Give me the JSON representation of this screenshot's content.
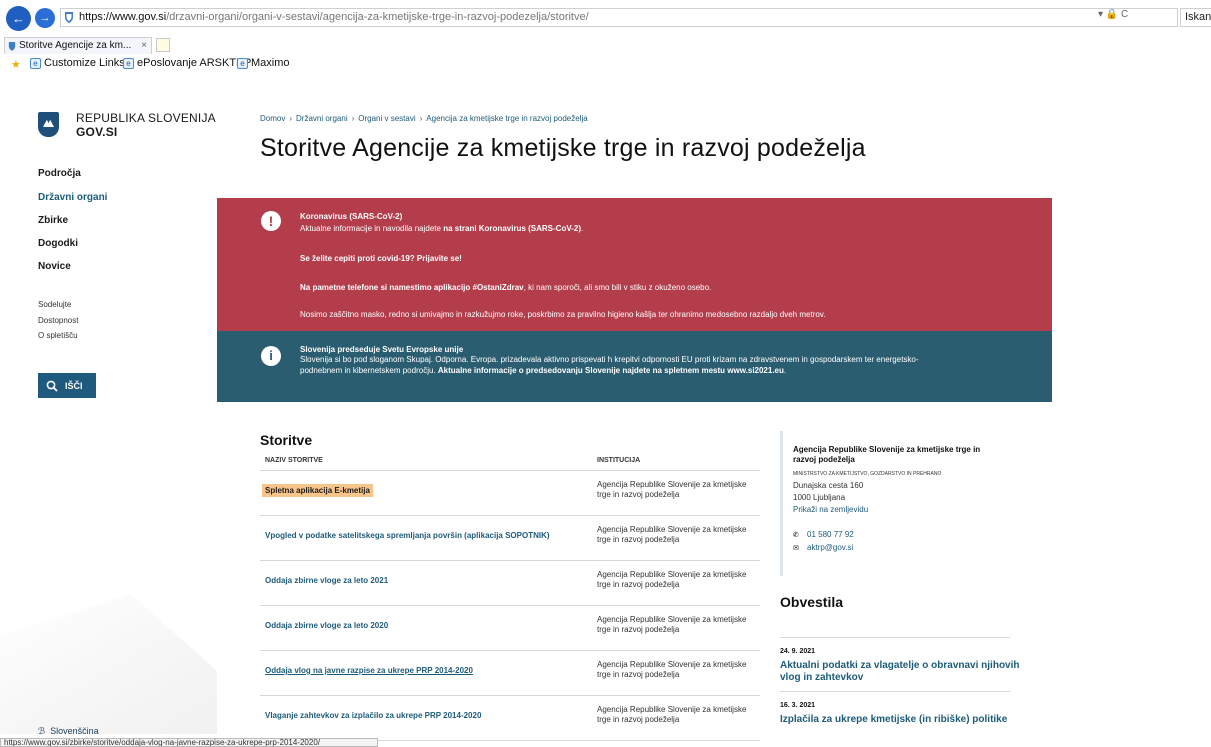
{
  "browser": {
    "url_host": "https://www.gov.si",
    "url_path": "/drzavni-organi/organi-v-sestavi/agencija-za-kmetijske-trge-in-razvoj-podezelja/storitve/",
    "url_tools": "▾ 🔒 C",
    "search_placeholder": "Iskanje",
    "tab_title": "Storitve Agencije za km...",
    "tab_close": "×",
    "favorites": [
      "Customize Links",
      "ePoslovanje ARSKTRP",
      "Maximo"
    ],
    "status_url": "https://www.gov.si/zbirke/storitve/oddaja-vlog-na-javne-razpise-za-ukrepe-prp-2014-2020/"
  },
  "logo": {
    "line1": "REPUBLIKA SLOVENIJA",
    "line2": "GOV.SI"
  },
  "sidebar": {
    "nav": [
      "Področja",
      "Državni organi",
      "Zbirke",
      "Dogodki",
      "Novice"
    ],
    "links": [
      "Sodelujte",
      "Dostopnost",
      "O spletišču"
    ],
    "search_label": "IŠČI",
    "language": "Slovenščina"
  },
  "breadcrumb": [
    "Domov",
    "Državni organi",
    "Organi v sestavi",
    "Agencija za kmetijske trge in razvoj podeželja"
  ],
  "page_title": "Storitve Agencije za kmetijske trge in razvoj podeželja",
  "covid_banner": {
    "title": "Koronavirus (SARS-CoV-2)",
    "line1_pre": "Aktualne informacije in navodila najdete ",
    "line1_link": "na strani Koronavirus (SARS-CoV-2)",
    "line1_post": ".",
    "vaccine": "Se želite cepiti proti covid-19? Prijavite se!",
    "app_bold": "Na pametne telefone si namestimo aplikacijo #OstaniZdrav",
    "app_rest": ", ki nam sporoči, ali smo bili v stiku z okuženo osebo.",
    "masks": "Nosimo zaščitno masko, redno si umivajmo in razkužujmo roke, poskrbimo za pravilno higieno kašlja ter ohranimo medosebno razdaljo dveh metrov."
  },
  "info_banner": {
    "title": "Slovenija predseduje Svetu Evropske unije",
    "line1": "Slovenija si bo pod sloganom Skupaj. Odporna. Evropa. prizadevala aktivno prispevati h krepitvi odpornosti EU proti krizam na zdravstvenem in gospodarskem ter energetsko-",
    "line2_pre": "podnebnem in kibernetskem področju. ",
    "line2_bold": "Aktualne informacije o predsedovanju Slovenije najdete na spletnem mestu www.si2021.eu",
    "line2_post": "."
  },
  "services": {
    "heading": "Storitve",
    "col_name": "NAZIV STORITVE",
    "col_institution": "INSTITUCIJA",
    "rows": [
      {
        "name": "Spletna aplikacija E-kmetija",
        "institution": "Agencija Republike Slovenije za kmetijske trge in razvoj podeželja"
      },
      {
        "name": "Vpogled v podatke satelitskega spremljanja površin (aplikacija SOPOTNIK)",
        "institution": "Agencija Republike Slovenije za kmetijske trge in razvoj podeželja"
      },
      {
        "name": "Oddaja zbirne vloge za leto 2021",
        "institution": "Agencija Republike Slovenije za kmetijske trge in razvoj podeželja"
      },
      {
        "name": "Oddaja zbirne vloge za leto 2020",
        "institution": "Agencija Republike Slovenije za kmetijske trge in razvoj podeželja"
      },
      {
        "name": "Oddaja vlog na javne razpise za ukrepe PRP 2014-2020",
        "institution": "Agencija Republike Slovenije za kmetijske trge in razvoj podeželja"
      },
      {
        "name": "Vlaganje zahtevkov za izplačilo za ukrepe PRP 2014-2020",
        "institution": "Agencija Republike Slovenije za kmetijske trge in razvoj podeželja"
      }
    ]
  },
  "contact": {
    "name": "Agencija Republike Slovenije za kmetijske trge in razvoj podeželja",
    "ministry": "MINISTRSTVO ZA KMETIJSTVO, GOZDARSTVO IN PREHRANO",
    "street": "Dunajska cesta 160",
    "city": "1000 Ljubljana",
    "map_link": "Prikaži na zemljevidu",
    "phone": "01 580 77 92",
    "email": "aktrp@gov.si"
  },
  "news": {
    "heading": "Obvestila",
    "items": [
      {
        "date": "24. 9. 2021",
        "title": "Aktualni podatki za vlagatelje o obravnavi njihovih vlog in zahtevkov"
      },
      {
        "date": "16. 3. 2021",
        "title": "Izplačila za ukrepe kmetijske (in ribiške) politike"
      }
    ]
  }
}
